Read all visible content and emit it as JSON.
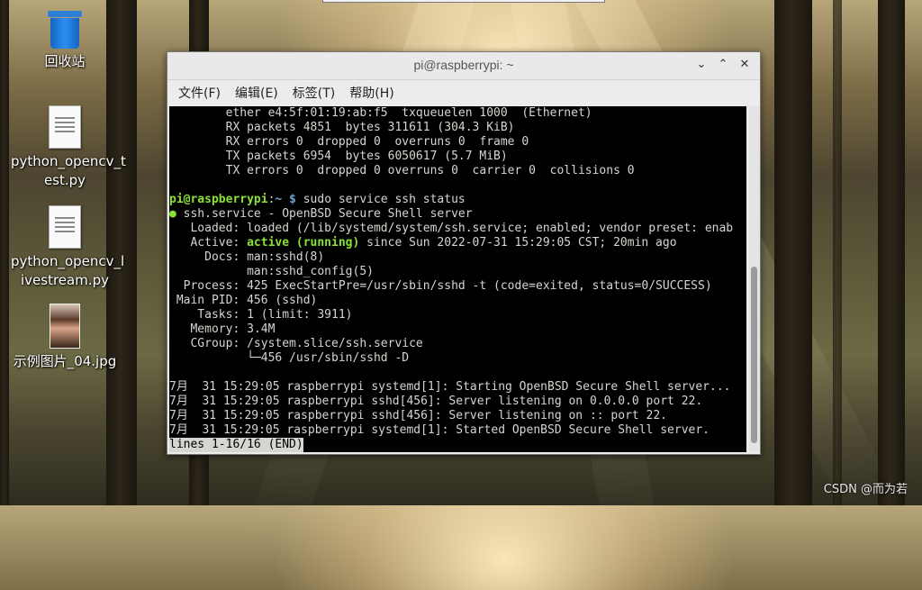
{
  "desktop": {
    "icons": [
      {
        "label": "回收站",
        "icon": "trash-icon"
      },
      {
        "label": "python_opencv_test.py",
        "line1": "python_opencv_t",
        "line2": "est.py",
        "icon": "python-file-icon"
      },
      {
        "label": "python_opencv_livestream.py",
        "line1": "python_opencv_l",
        "line2": "ivestream.py",
        "icon": "python-file-icon"
      },
      {
        "label": "示例图片_04.jpg",
        "icon": "image-file-icon"
      }
    ],
    "watermark": "CSDN @而为若"
  },
  "window": {
    "title": "pi@raspberrypi: ~",
    "menus": [
      "文件(F)",
      "编辑(E)",
      "标签(T)",
      "帮助(H)"
    ]
  },
  "terminal": {
    "lines": [
      "        ether e4:5f:01:19:ab:f5  txqueuelen 1000  (Ethernet)",
      "        RX packets 4851  bytes 311611 (304.3 KiB)",
      "        RX errors 0  dropped 0  overruns 0  frame 0",
      "        TX packets 6954  bytes 6050617 (5.7 MiB)",
      "        TX errors 0  dropped 0 overruns 0  carrier 0  collisions 0",
      ""
    ],
    "prompt": {
      "user": "pi@raspberrypi",
      "sep": ":",
      "path": "~",
      "dollar": " $ ",
      "command": "sudo service ssh status"
    },
    "service_header": {
      "dot": "●",
      "text": " ssh.service - OpenBSD Secure Shell server"
    },
    "loaded": "   Loaded: loaded (/lib/systemd/system/ssh.service; enabled; vendor preset: enab",
    "active": {
      "label": "   Active: ",
      "state": "active (running)",
      "rest": " since Sun 2022-07-31 15:29:05 CST; 20min ago"
    },
    "details": [
      "     Docs: man:sshd(8)",
      "           man:sshd_config(5)",
      "  Process: 425 ExecStartPre=/usr/sbin/sshd -t (code=exited, status=0/SUCCESS)",
      " Main PID: 456 (sshd)",
      "    Tasks: 1 (limit: 3911)",
      "   Memory: 3.4M",
      "   CGroup: /system.slice/ssh.service",
      "           └─456 /usr/sbin/sshd -D",
      "",
      "7月  31 15:29:05 raspberrypi systemd[1]: Starting OpenBSD Secure Shell server...",
      "7月  31 15:29:05 raspberrypi sshd[456]: Server listening on 0.0.0.0 port 22.",
      "7月  31 15:29:05 raspberrypi sshd[456]: Server listening on :: port 22.",
      "7月  31 15:29:05 raspberrypi systemd[1]: Started OpenBSD Secure Shell server."
    ],
    "pager_status": "lines 1-16/16 (END)"
  }
}
